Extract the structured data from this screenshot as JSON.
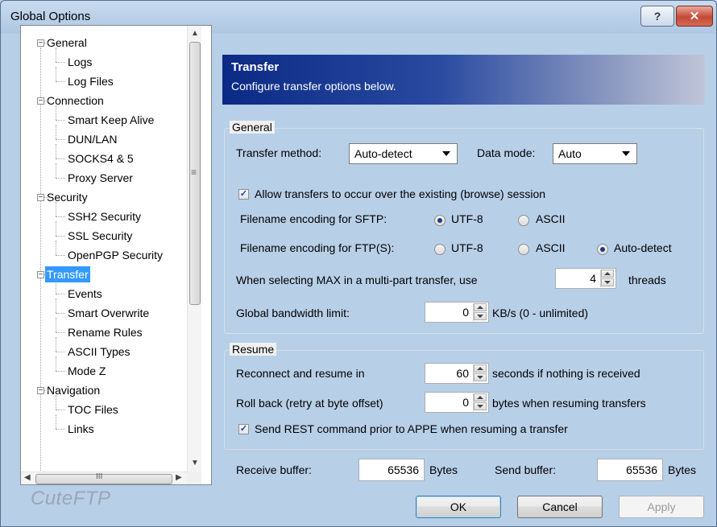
{
  "window": {
    "title": "Global Options",
    "help_glyph": "?",
    "close_glyph": "✕"
  },
  "tree": {
    "items": [
      {
        "label": "General",
        "level": 0,
        "expander": "−"
      },
      {
        "label": "Logs",
        "level": 1
      },
      {
        "label": "Log Files",
        "level": 1
      },
      {
        "label": "Connection",
        "level": 0,
        "expander": "−"
      },
      {
        "label": "Smart Keep Alive",
        "level": 1
      },
      {
        "label": "DUN/LAN",
        "level": 1
      },
      {
        "label": "SOCKS4 & 5",
        "level": 1
      },
      {
        "label": "Proxy Server",
        "level": 1
      },
      {
        "label": "Security",
        "level": 0,
        "expander": "−"
      },
      {
        "label": "SSH2 Security",
        "level": 1
      },
      {
        "label": "SSL Security",
        "level": 1
      },
      {
        "label": "OpenPGP Security",
        "level": 1
      },
      {
        "label": "Transfer",
        "level": 0,
        "expander": "−",
        "selected": true
      },
      {
        "label": "Events",
        "level": 1
      },
      {
        "label": "Smart Overwrite",
        "level": 1
      },
      {
        "label": "Rename Rules",
        "level": 1
      },
      {
        "label": "ASCII Types",
        "level": 1
      },
      {
        "label": "Mode Z",
        "level": 1
      },
      {
        "label": "Navigation",
        "level": 0,
        "expander": "−"
      },
      {
        "label": "TOC Files",
        "level": 1
      },
      {
        "label": "Links",
        "level": 1
      }
    ],
    "scroll_thumb_grip": "≡",
    "hscroll_grip": "III"
  },
  "brand": "CuteFTP",
  "header": {
    "title": "Transfer",
    "subtitle": "Configure transfer options below."
  },
  "general": {
    "legend": "General",
    "transfer_method_label": "Transfer method:",
    "transfer_method_value": "Auto-detect",
    "data_mode_label": "Data mode:",
    "data_mode_value": "Auto",
    "allow_existing_session_label": "Allow transfers to occur over the existing (browse) session",
    "allow_existing_session_checked": true,
    "sftp_encoding_label": "Filename encoding for SFTP:",
    "sftp_options": [
      "UTF-8",
      "ASCII"
    ],
    "sftp_selected": "UTF-8",
    "ftps_encoding_label": "Filename encoding for FTP(S):",
    "ftps_options": [
      "UTF-8",
      "ASCII",
      "Auto-detect"
    ],
    "ftps_selected": "Auto-detect",
    "max_threads_label": "When selecting MAX in a multi-part transfer, use",
    "max_threads_value": "4",
    "threads_unit": "threads",
    "bandwidth_label": "Global bandwidth limit:",
    "bandwidth_value": "0",
    "bandwidth_unit": "KB/s (0 - unlimited)"
  },
  "resume": {
    "legend": "Resume",
    "reconnect_label": "Reconnect and resume in",
    "reconnect_value": "60",
    "reconnect_unit": "seconds if nothing is received",
    "rollback_label": "Roll back (retry at byte offset)",
    "rollback_value": "0",
    "rollback_unit": "bytes when resuming transfers",
    "send_rest_label": "Send REST command prior to APPE when resuming a transfer",
    "send_rest_checked": true
  },
  "buffers": {
    "receive_label": "Receive buffer:",
    "receive_value": "65536",
    "receive_unit": "Bytes",
    "send_label": "Send buffer:",
    "send_value": "65536",
    "send_unit": "Bytes"
  },
  "buttons": {
    "ok": "OK",
    "cancel": "Cancel",
    "apply": "Apply"
  }
}
